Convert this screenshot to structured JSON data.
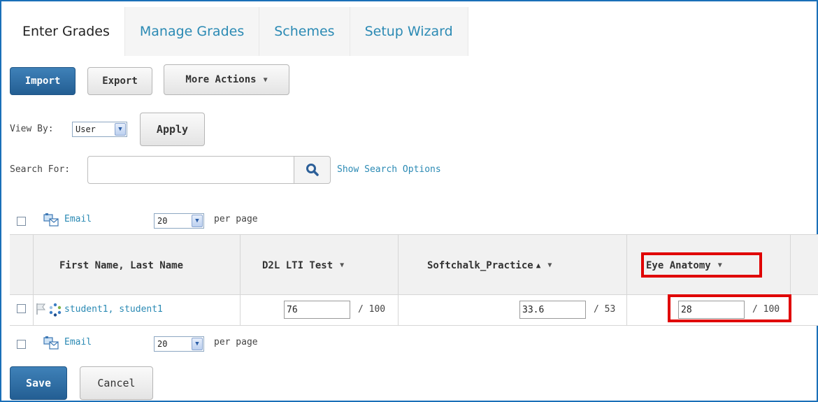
{
  "tabs": [
    {
      "label": "Enter Grades",
      "active": true
    },
    {
      "label": "Manage Grades",
      "active": false
    },
    {
      "label": "Schemes",
      "active": false
    },
    {
      "label": "Setup Wizard",
      "active": false
    }
  ],
  "toolbar": {
    "import_label": "Import",
    "export_label": "Export",
    "more_actions_label": "More Actions"
  },
  "view_by": {
    "label": "View By:",
    "selected": "User",
    "apply_label": "Apply"
  },
  "search": {
    "label": "Search For:",
    "value": "",
    "options_link": "Show Search Options"
  },
  "paging_top": {
    "email_label": "Email",
    "per_page_value": "20",
    "per_page_label": "per page"
  },
  "table": {
    "columns": [
      {
        "label": "First Name, Last Name"
      },
      {
        "label": "D2L LTI Test"
      },
      {
        "label": "Softchalk_Practice",
        "sort": "▲"
      },
      {
        "label": "Eye Anatomy"
      }
    ],
    "rows": [
      {
        "name": "student1, student1",
        "grades": [
          {
            "value": "76",
            "out_of": "/ 100"
          },
          {
            "value": "33.6",
            "out_of": "/ 53"
          },
          {
            "value": "28",
            "out_of": "/ 100"
          }
        ]
      }
    ]
  },
  "paging_bottom": {
    "email_label": "Email",
    "per_page_value": "20",
    "per_page_label": "per page"
  },
  "footer": {
    "save_label": "Save",
    "cancel_label": "Cancel"
  },
  "colors": {
    "frame": "#1a6fb8",
    "primary_button": "#235e93",
    "link": "#2b8ab4",
    "highlight": "#e00000"
  }
}
